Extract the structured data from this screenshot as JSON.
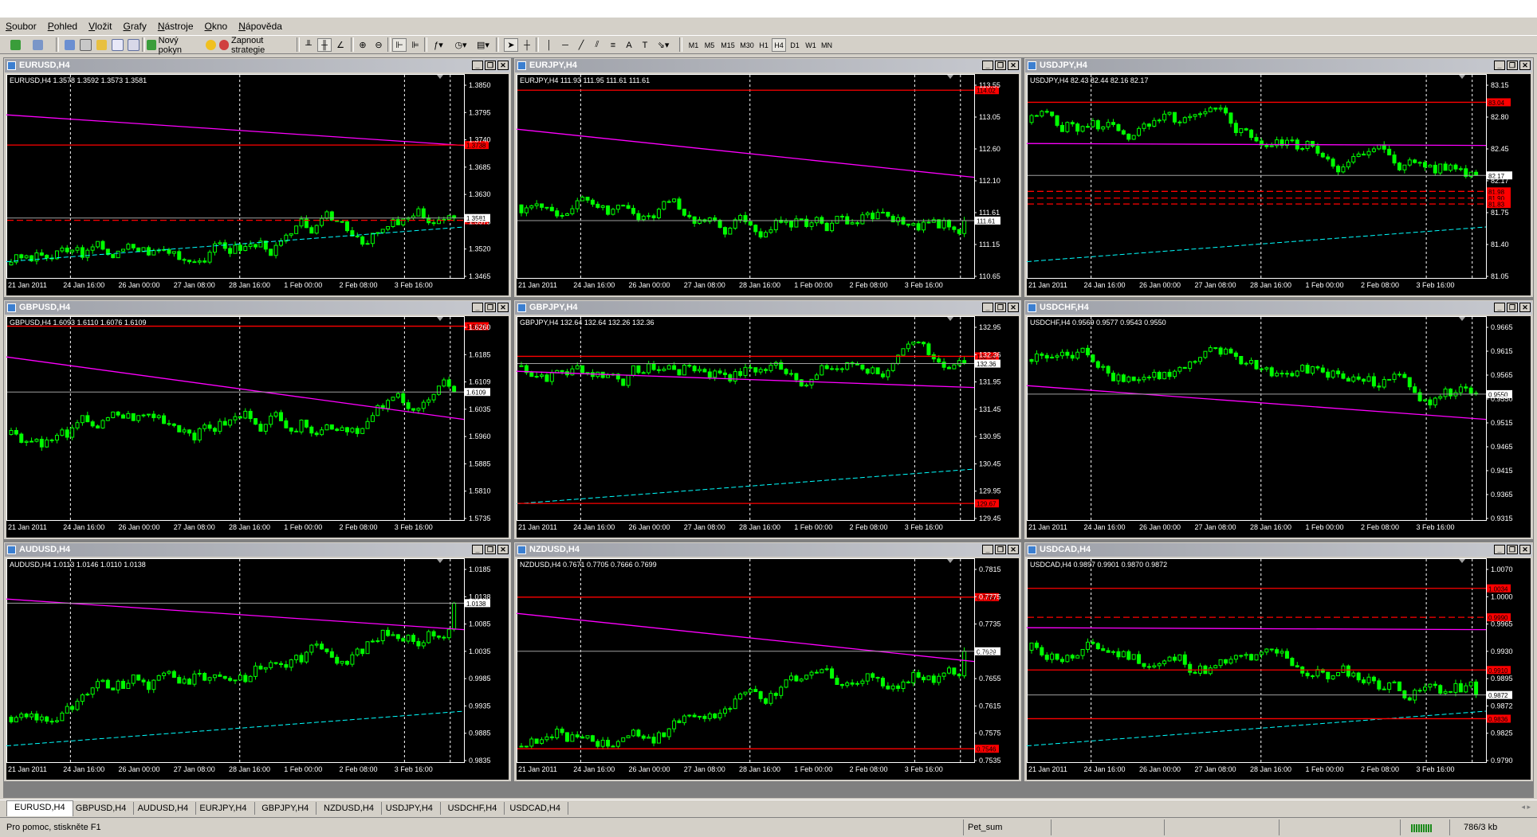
{
  "menu": [
    "Soubor",
    "Pohled",
    "Vložit",
    "Grafy",
    "Nástroje",
    "Okno",
    "Nápověda"
  ],
  "toolbar": {
    "new_order": "Nový pokyn",
    "strategies": "Zapnout strategie",
    "timeframes": [
      "M1",
      "M5",
      "M15",
      "M30",
      "H1",
      "H4",
      "D1",
      "W1",
      "MN"
    ],
    "active_tf": "H4"
  },
  "colors": {
    "chart_bg": "#000000",
    "candle": "#00ff00",
    "support": "#ff0000",
    "trend": "#ff00ff",
    "channel": "#00ffff",
    "price": "#a0a0a0",
    "axis": "#ffffff"
  },
  "xlabels": [
    "21 Jan 2011",
    "24 Jan 16:00",
    "26 Jan 00:00",
    "27 Jan 08:00",
    "28 Jan 16:00",
    "1 Feb 00:00",
    "2 Feb 08:00",
    "3 Feb 16:00"
  ],
  "charts": [
    {
      "title": "EURUSD,H4",
      "info": "EURUSD,H4  1.3578 1.3592 1.3573 1.3581",
      "ticks": [
        "1.3850",
        "1.3795",
        "1.3740",
        "1.3685",
        "1.3630",
        "1.3575",
        "1.3520",
        "1.3465"
      ],
      "ymax": 1.3877,
      "ymin": 1.3452,
      "start": 1.348,
      "close": 1.3581,
      "bid": "1.3581",
      "redlines": [
        {
          "v": 1.3738,
          "label": "1.3738"
        },
        {
          "v": 1.3576,
          "label": "1.3576",
          "dash": true
        }
      ]
    },
    {
      "title": "EURJPY,H4",
      "info": "EURJPY,H4  111.93 111.95 111.61 111.61",
      "ticks": [
        "113.55",
        "113.05",
        "112.60",
        "112.10",
        "111.61",
        "111.15",
        "110.65"
      ],
      "ymax": 114.2,
      "ymin": 110.55,
      "start": 111.9,
      "close": 111.61,
      "bid": "111.61",
      "redlines": [
        {
          "v": 114.02,
          "label": "114.02"
        }
      ]
    },
    {
      "title": "USDJPY,H4",
      "info": "USDJPY,H4  82.43 82.44 82.16 82.17",
      "ticks": [
        "83.15",
        "82.80",
        "82.45",
        "82.17",
        "81.75",
        "81.40",
        "81.05"
      ],
      "ymax": 83.3,
      "ymin": 80.95,
      "start": 82.8,
      "close": 82.17,
      "bid": "82.17",
      "redlines": [
        {
          "v": 83.04,
          "label": "83.04"
        },
        {
          "v": 81.98,
          "label": "81.98",
          "dash": true
        },
        {
          "v": 81.9,
          "label": "81.90",
          "dash": true
        },
        {
          "v": 81.83,
          "label": "81.83",
          "dash": true
        }
      ]
    },
    {
      "title": "GBPUSD,H4",
      "info": "GBPUSD,H4  1.6093 1.6110 1.6076 1.6109",
      "ticks": [
        "1.6260",
        "1.6185",
        "1.6109",
        "1.6035",
        "1.5960",
        "1.5885",
        "1.5810",
        "1.5735"
      ],
      "ymax": 1.632,
      "ymin": 1.572,
      "start": 1.598,
      "close": 1.6109,
      "bid": "1.6109",
      "redlines": [
        {
          "v": 1.6309,
          "label": "1.6309"
        }
      ]
    },
    {
      "title": "GBPJPY,H4",
      "info": "GBPJPY,H4  132.64 132.64 132.26 132.36",
      "ticks": [
        "132.95",
        "132.36",
        "131.95",
        "131.45",
        "130.95",
        "130.45",
        "129.95",
        "129.45"
      ],
      "ymax": 133.15,
      "ymin": 129.35,
      "start": 132.3,
      "close": 132.36,
      "bid": "132.36",
      "redlines": [
        {
          "v": 132.5,
          "label": "132.50"
        },
        {
          "v": 129.67,
          "label": "129.67"
        }
      ]
    },
    {
      "title": "USDCHF,H4",
      "info": "USDCHF,H4  0.9569 0.9577 0.9543 0.9550",
      "ticks": [
        "0.9665",
        "0.9615",
        "0.9565",
        "0.9550",
        "0.9515",
        "0.9465",
        "0.9415",
        "0.9365",
        "0.9315"
      ],
      "ymax": 0.9695,
      "ymin": 0.9295,
      "start": 0.962,
      "close": 0.955,
      "bid": "0.9550",
      "redlines": []
    },
    {
      "title": "AUDUSD,H4",
      "info": "AUDUSD,H4  1.0113 1.0146 1.0110 1.0138",
      "ticks": [
        "1.0185",
        "1.0138",
        "1.0085",
        "1.0035",
        "0.9985",
        "0.9935",
        "0.9885",
        "0.9835"
      ],
      "ymax": 1.0215,
      "ymin": 0.982,
      "start": 0.991,
      "close": 1.0138,
      "bid": "1.0138",
      "redlines": []
    },
    {
      "title": "NZDUSD,H4",
      "info": "NZDUSD,H4  0.7671 0.7705 0.7666 0.7699",
      "ticks": [
        "0.7815",
        "0.7775",
        "0.7735",
        "0.7699",
        "0.7655",
        "0.7615",
        "0.7575",
        "0.7535"
      ],
      "ymax": 0.7835,
      "ymin": 0.7525,
      "start": 0.755,
      "close": 0.7699,
      "bid": "0.7699",
      "redlines": [
        {
          "v": 0.7784,
          "label": "0.7784"
        },
        {
          "v": 0.7546,
          "label": "0.7546"
        }
      ]
    },
    {
      "title": "USDCAD,H4",
      "info": "USDCAD,H4  0.9897 0.9901 0.9870 0.9872",
      "ticks": [
        "1.0070",
        "1.0000",
        "0.9965",
        "0.9930",
        "0.9895",
        "0.9872",
        "0.9825",
        "0.9790"
      ],
      "ymax": 1.007,
      "ymin": 0.977,
      "start": 0.994,
      "close": 0.9872,
      "bid": "0.9872",
      "redlines": [
        {
          "v": 1.0034,
          "label": "1.0034"
        },
        {
          "v": 0.999,
          "label": "0.9990",
          "dash": true
        },
        {
          "v": 0.991,
          "label": "0.9910"
        },
        {
          "v": 0.9836,
          "label": "0.9836"
        }
      ]
    }
  ],
  "tabs": [
    "EURUSD,H4",
    "GBPUSD,H4",
    "AUDUSD,H4",
    "EURJPY,H4",
    "GBPJPY,H4",
    "NZDUSD,H4",
    "USDJPY,H4",
    "USDCHF,H4",
    "USDCAD,H4"
  ],
  "status": {
    "help": "Pro pomoc, stiskněte F1",
    "profile": "Pet_sum",
    "traffic": "786/3 kb"
  }
}
